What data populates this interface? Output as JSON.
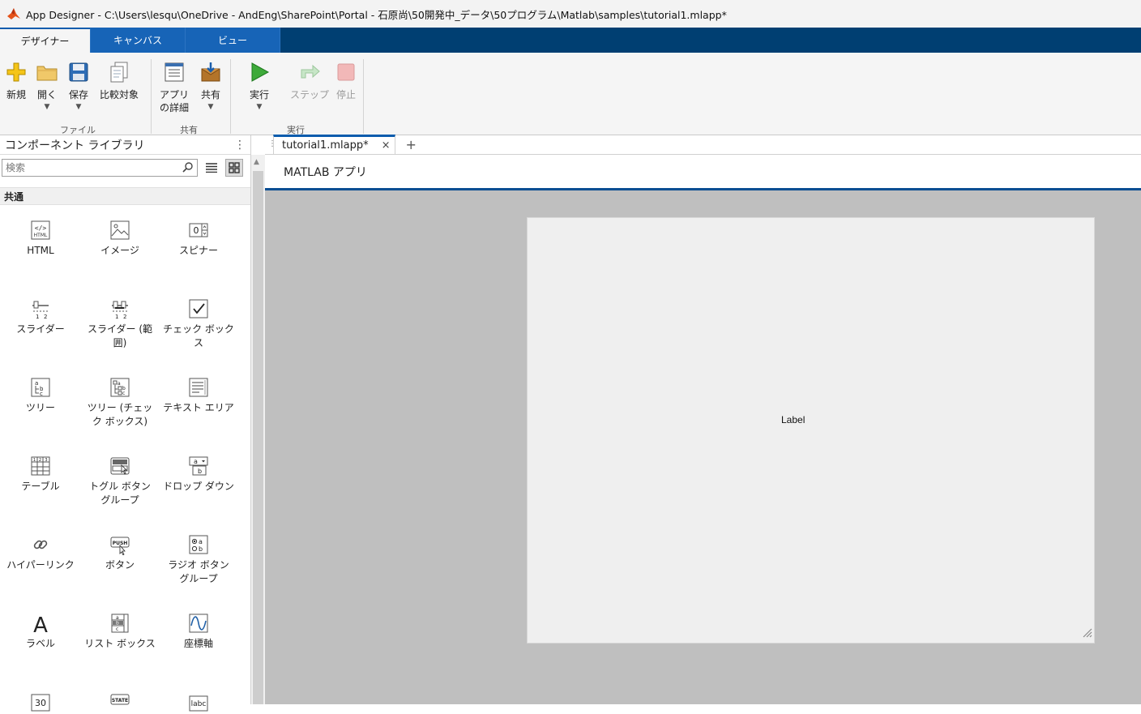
{
  "window": {
    "title": "App Designer - C:\\Users\\lesqu\\OneDrive - AndEng\\SharePoint\\Portal - 石原尚\\50開発中_データ\\50プログラム\\Matlab\\samples\\tutorial1.mlapp*"
  },
  "ribbon": {
    "tabs": [
      {
        "label": "デザイナー",
        "active": true
      },
      {
        "label": "キャンバス",
        "active": false
      },
      {
        "label": "ビュー",
        "active": false
      }
    ],
    "groups": {
      "file": {
        "label": "ファイル",
        "new": "新規",
        "open": "開く",
        "save": "保存",
        "compare": "比較対象"
      },
      "share": {
        "label": "共有",
        "app_details": "アプリの詳細",
        "share": "共有"
      },
      "run": {
        "label": "実行",
        "run": "実行",
        "step": "ステップ",
        "stop": "停止"
      }
    }
  },
  "library": {
    "title": "コンポーネント ライブラリ",
    "search_placeholder": "検索",
    "section": "共通",
    "components": [
      {
        "label": "HTML",
        "icon": "html-icon"
      },
      {
        "label": "イメージ",
        "icon": "image-icon"
      },
      {
        "label": "スピナー",
        "icon": "spinner-icon"
      },
      {
        "label": "スライダー",
        "icon": "slider-icon"
      },
      {
        "label": "スライダー (範囲)",
        "icon": "range-slider-icon"
      },
      {
        "label": "チェック ボックス",
        "icon": "checkbox-icon"
      },
      {
        "label": "ツリー",
        "icon": "tree-icon"
      },
      {
        "label": "ツリー (チェック ボックス)",
        "icon": "checkbox-tree-icon"
      },
      {
        "label": "テキスト エリア",
        "icon": "text-area-icon"
      },
      {
        "label": "テーブル",
        "icon": "table-icon"
      },
      {
        "label": "トグル ボタン グループ",
        "icon": "toggle-button-group-icon"
      },
      {
        "label": "ドロップ ダウン",
        "icon": "dropdown-icon"
      },
      {
        "label": "ハイパーリンク",
        "icon": "hyperlink-icon"
      },
      {
        "label": "ボタン",
        "icon": "button-icon"
      },
      {
        "label": "ラジオ ボタン グループ",
        "icon": "radio-button-group-icon"
      },
      {
        "label": "ラベル",
        "icon": "label-icon"
      },
      {
        "label": "リスト ボックス",
        "icon": "list-box-icon"
      },
      {
        "label": "座標軸",
        "icon": "axes-icon"
      }
    ],
    "partial_icons": {
      "numeric": "30",
      "state": "STATE",
      "edit": "labc"
    }
  },
  "document": {
    "tab": "tutorial1.mlapp*",
    "close": "×",
    "add": "+",
    "header": "MATLAB アプリ"
  },
  "canvas": {
    "label_text": "Label"
  },
  "colors": {
    "ribbon_dark": "#003f72",
    "tab_blue": "#1764b7",
    "canvas_bg": "#bfbfbf",
    "figure_bg": "#efefef",
    "accent": "#0b4e92"
  }
}
